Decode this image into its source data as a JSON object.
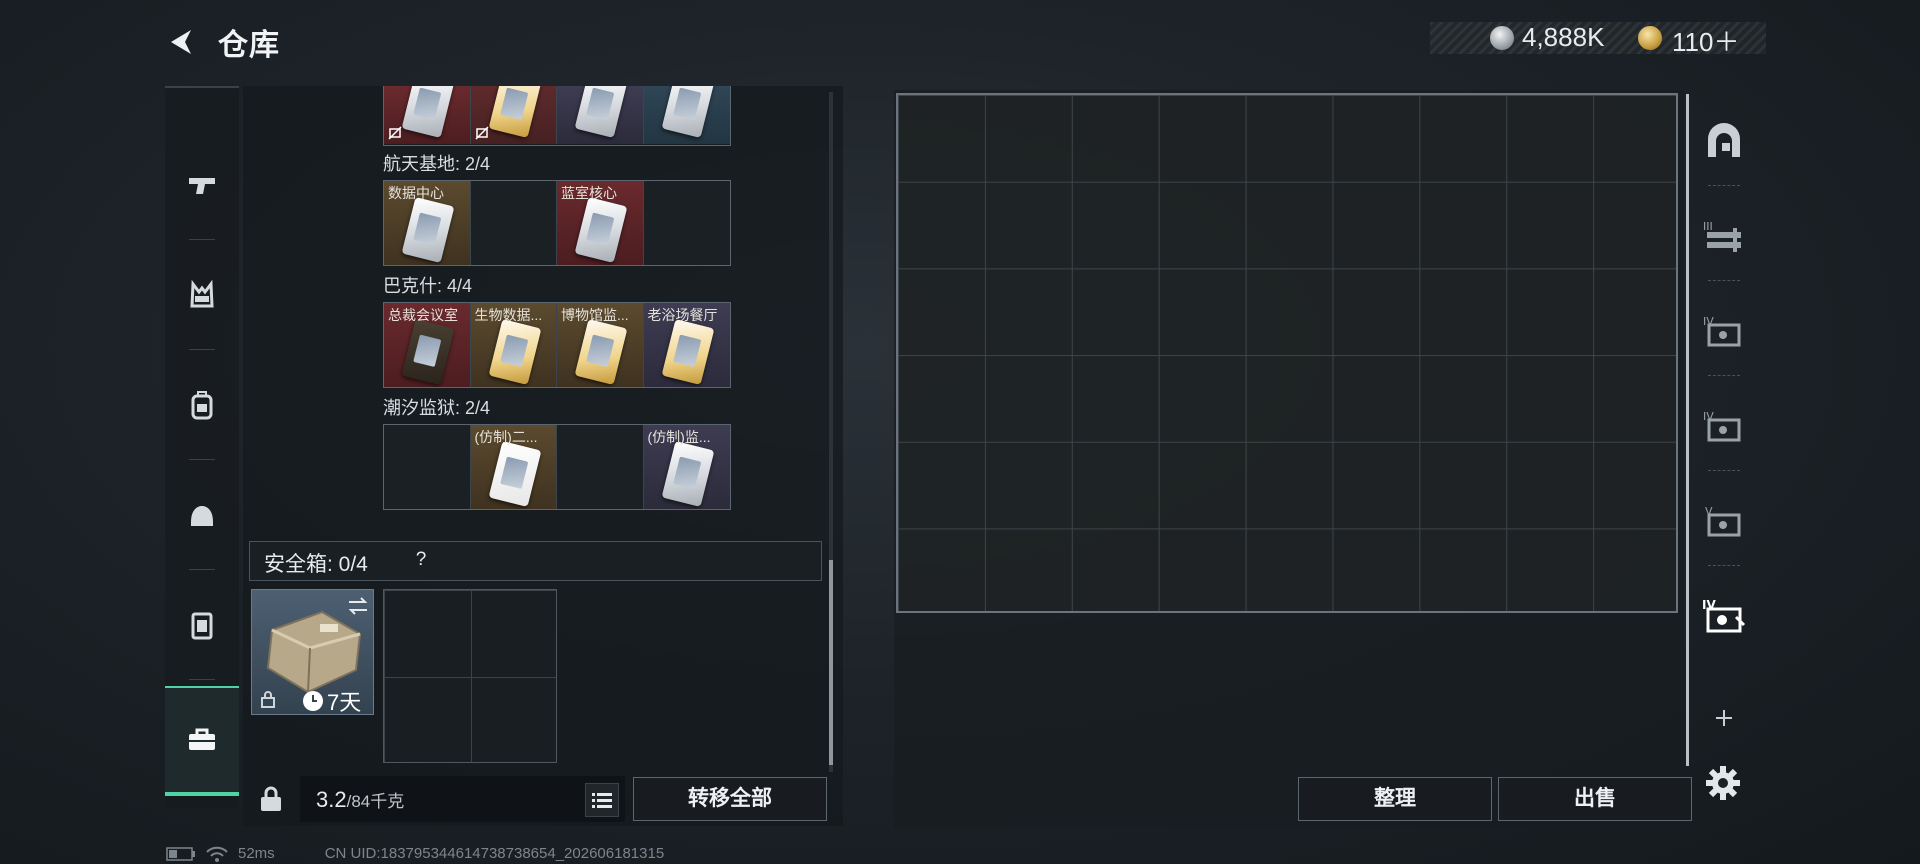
{
  "header": {
    "title": "仓库",
    "currency1": "4,888K",
    "currency2": "110＋"
  },
  "keycards": {
    "sections": [
      {
        "label": "航天基地: 2/4",
        "cells": [
          "数据中心",
          "",
          "蓝室核心",
          ""
        ]
      },
      {
        "label": "巴克什: 4/4",
        "cells": [
          "总裁会议室",
          "生物数据...",
          "博物馆监...",
          "老浴场餐厅"
        ]
      },
      {
        "label": "潮汐监狱: 2/4",
        "cells": [
          "",
          "(仿制)二...",
          "",
          "(仿制)监..."
        ]
      }
    ]
  },
  "safebox": {
    "label": "安全箱: 0/4",
    "help": "?",
    "timer": "7天"
  },
  "footer": {
    "weight_value": "3.2",
    "weight_cap": "/84千克",
    "transfer_all": "转移全部",
    "sort": "整理",
    "sell": "出售"
  },
  "status": {
    "ping": "52ms",
    "uid": "CN UID:1837953446147387386​54_202606181315"
  },
  "icons": {
    "left_rail": [
      "pistol-icon",
      "vest-icon",
      "backpack-icon",
      "helmet-icon",
      "case-icon",
      "toolbox-icon"
    ],
    "right_rail": [
      "storage-arch-icon",
      "rack-icon",
      "keycard-iv-icon",
      "keycard-iv-icon",
      "keycard-v-icon",
      "keycard-iv-active-icon"
    ]
  },
  "colors": {
    "accent": "#4dd3a4",
    "card_red": "#6a2a2e",
    "card_gold": "#5b4a2e",
    "card_purple": "#3e3c52"
  }
}
